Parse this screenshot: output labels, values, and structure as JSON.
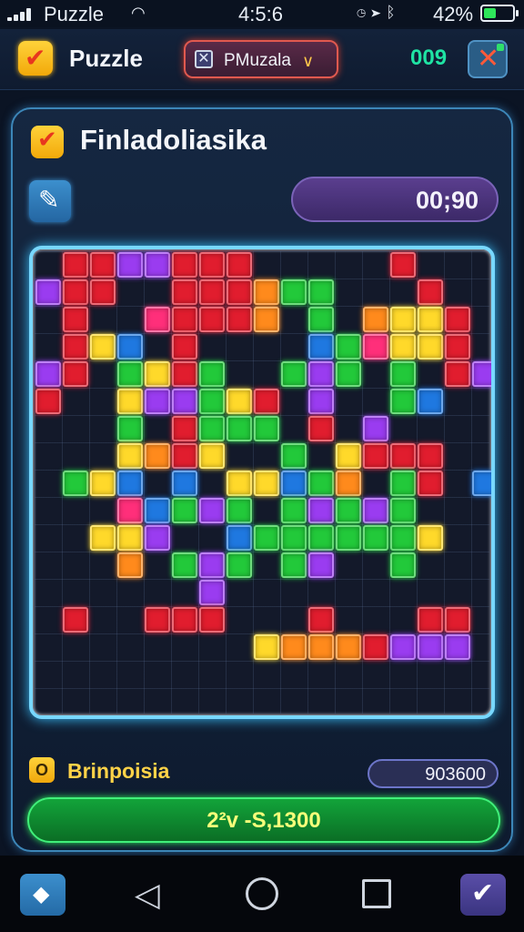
{
  "status_bar": {
    "app_label": "Puzzle",
    "time": "4:5:6",
    "battery_text": "42%",
    "battery_level": 0.42,
    "icons": [
      "signal-icon",
      "wifi-icon",
      "alarm-icon",
      "location-icon",
      "bluetooth-icon",
      "battery-icon"
    ]
  },
  "header": {
    "title": "Puzzle",
    "mode_selector": "PMuzala",
    "score": "009"
  },
  "panel": {
    "level_title": "Finladoliasika",
    "timer": "00;90"
  },
  "footer": {
    "stat_icon_text": "O",
    "stat_label": "Brinpoisia",
    "stat_value": "903600",
    "progress_text": "2²v -S,1300"
  },
  "colors": {
    "accent": "#78d8ff",
    "red": "#e11d2e",
    "green": "#22c93a",
    "yellow": "#ffd92a",
    "orange": "#ff8a1c",
    "purple": "#9a3cf0",
    "blue": "#1f78e0",
    "pink": "#ff2f7a",
    "cyan": "#1fa6ff"
  },
  "board": {
    "columns": 17,
    "rows": 17,
    "tiles": [
      "0-1-R",
      "0-2-R",
      "0-3-P",
      "0-4-P",
      "0-5-R",
      "0-6-R",
      "0-7-R",
      "0-13-R",
      "1-0-M",
      "1-1-R",
      "1-2-R",
      "1-5-R",
      "1-6-R",
      "1-7-R",
      "1-8-O",
      "1-9-G",
      "1-10-G",
      "1-14-R",
      "2-1-R",
      "2-4-K",
      "2-5-R",
      "2-6-R",
      "2-7-R",
      "2-8-O",
      "2-10-G",
      "2-12-O",
      "2-13-Y",
      "2-14-Y",
      "2-15-R",
      "3-1-R",
      "3-2-Y",
      "3-3-B",
      "3-5-R",
      "3-10-B",
      "3-11-G",
      "3-12-K",
      "3-13-Y",
      "3-14-Y",
      "3-15-R",
      "4-0-P",
      "4-1-R",
      "4-3-G",
      "4-4-Y",
      "4-5-R",
      "4-6-G",
      "4-9-G",
      "4-10-P",
      "4-11-G",
      "4-13-G",
      "4-15-R",
      "4-16-P",
      "5-0-R",
      "5-3-Y",
      "5-4-M",
      "5-5-P",
      "5-6-G",
      "5-7-Y",
      "5-8-R",
      "5-10-P",
      "5-13-G",
      "5-14-B",
      "6-3-G",
      "6-5-R",
      "6-6-G",
      "6-7-G",
      "6-8-G",
      "6-10-R",
      "6-12-P",
      "7-3-Y",
      "7-4-O",
      "7-5-R",
      "7-6-Y",
      "7-9-G",
      "7-11-Y",
      "7-12-R",
      "7-13-R",
      "7-14-R",
      "8-1-G",
      "8-2-Y",
      "8-3-B",
      "8-5-B",
      "8-7-Y",
      "8-8-Y",
      "8-9-B",
      "8-10-G",
      "8-11-O",
      "8-13-G",
      "8-14-R",
      "8-16-B",
      "9-3-K",
      "9-4-B",
      "9-5-G",
      "9-6-P",
      "9-7-G",
      "9-9-G",
      "9-10-P",
      "9-11-G",
      "9-12-P",
      "9-13-G",
      "10-2-Y",
      "10-3-Y",
      "10-4-P",
      "10-7-B",
      "10-8-G",
      "10-9-G",
      "10-10-G",
      "10-11-G",
      "10-12-G",
      "10-13-G",
      "10-14-Y",
      "11-3-O",
      "11-5-G",
      "11-6-P",
      "11-7-G",
      "11-9-G",
      "11-10-P",
      "11-13-G",
      "12-6-P",
      "13-1-R",
      "13-4-R",
      "13-5-R",
      "13-6-R",
      "13-10-R",
      "13-14-R",
      "13-15-R",
      "14-8-Y",
      "14-9-O",
      "14-10-O",
      "14-11-O",
      "14-12-R",
      "14-13-P",
      "14-14-P",
      "14-15-M"
    ]
  }
}
